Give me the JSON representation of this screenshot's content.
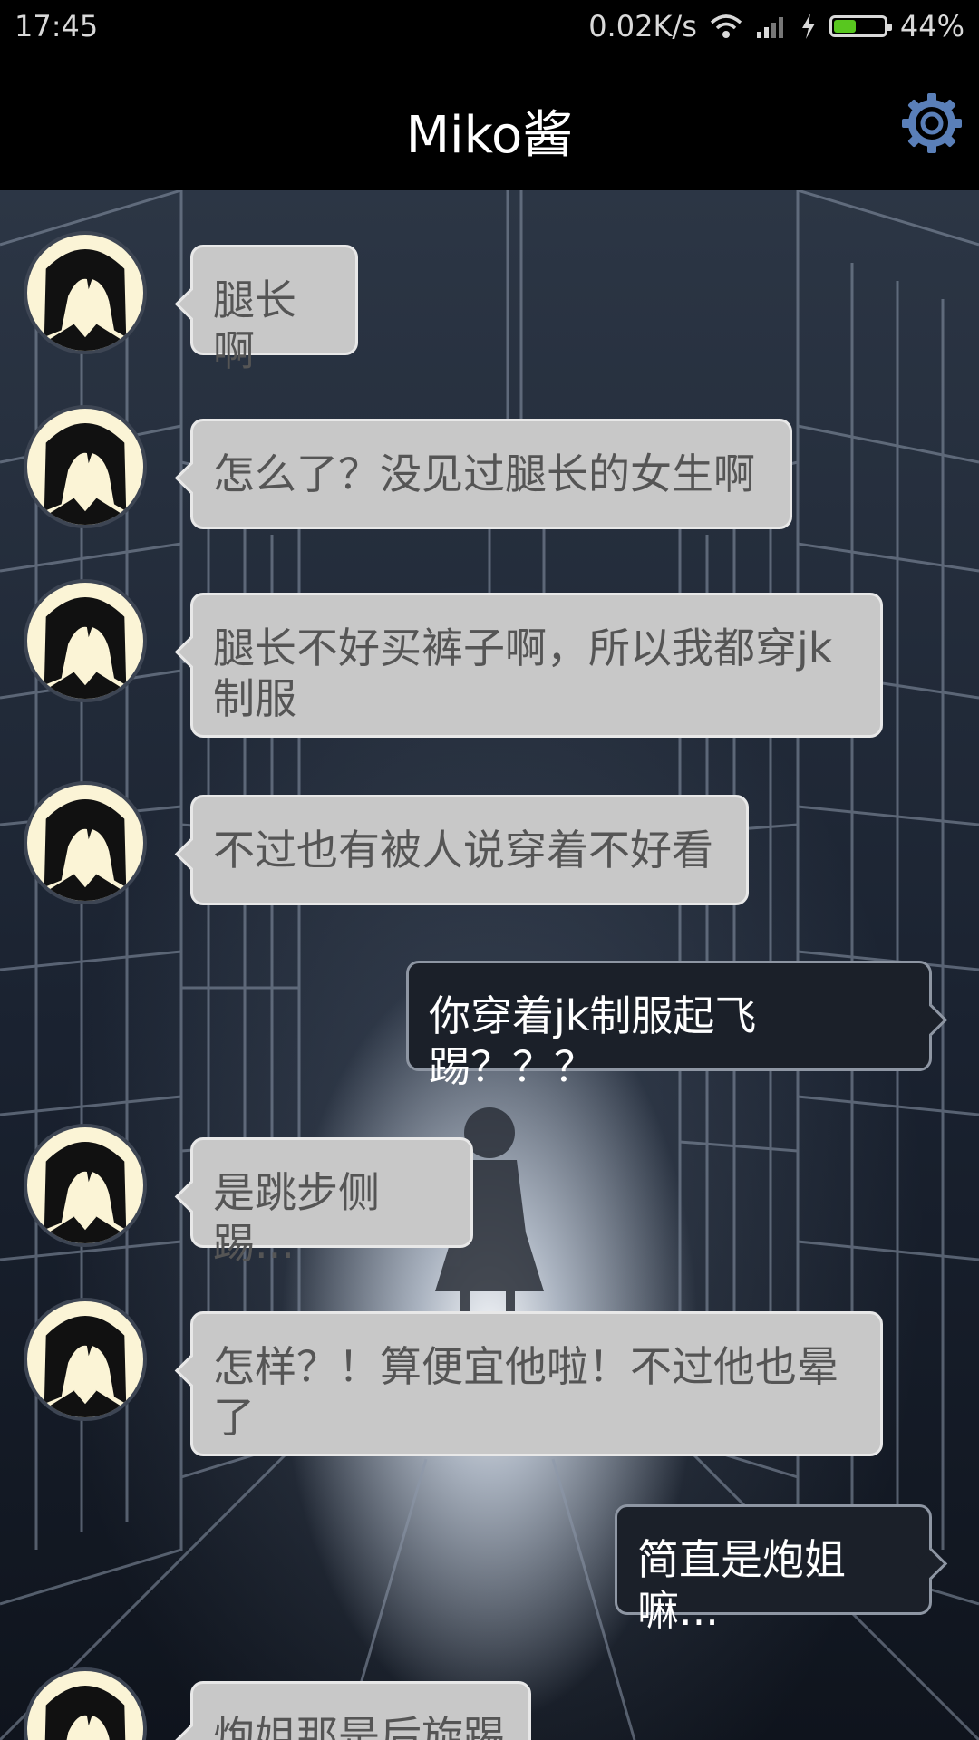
{
  "status_bar": {
    "time": "17:45",
    "network_speed": "0.02K/s",
    "battery_percent": "44%",
    "battery_level": 0.44,
    "icons": [
      "wifi-icon",
      "signal-icon",
      "charging-icon",
      "battery-icon"
    ]
  },
  "header": {
    "title": "Miko酱",
    "settings_icon": "gear-icon"
  },
  "colors": {
    "incoming_bubble": "#c8c8c8",
    "outgoing_bubble": "#1b2029",
    "gear": "#5a7fb8"
  },
  "messages": [
    {
      "from": "miko",
      "text": "腿长啊"
    },
    {
      "from": "miko",
      "text": "怎么了？没见过腿长的女生啊"
    },
    {
      "from": "miko",
      "text": "腿长不好买裤子啊，所以我都穿jk制服"
    },
    {
      "from": "miko",
      "text": "不过也有被人说穿着不好看"
    },
    {
      "from": "me",
      "text": "你穿着jk制服起飞踢？？？"
    },
    {
      "from": "miko",
      "text": "是跳步侧踢..."
    },
    {
      "from": "miko",
      "text": "怎样？！算便宜他啦！不过他也晕了"
    },
    {
      "from": "me",
      "text": "简直是炮姐嘛..."
    },
    {
      "from": "miko",
      "text": "炮姐那是后旋踢"
    }
  ]
}
